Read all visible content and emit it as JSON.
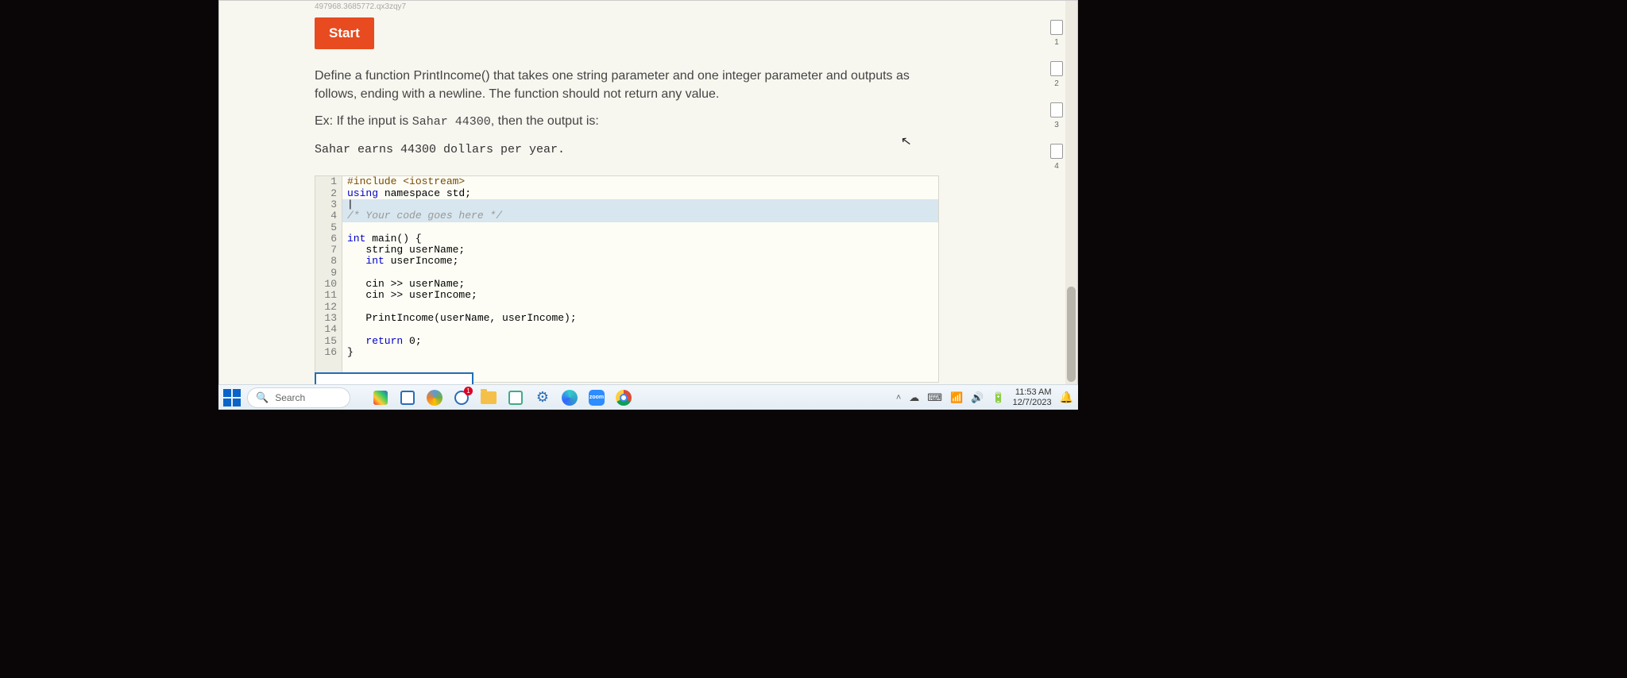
{
  "header_hash": "497968.3685772.qx3zqy7",
  "start_label": "Start",
  "prompt_text": "Define a function PrintIncome() that takes one string parameter and one integer parameter and outputs as follows, ending with a newline. The function should not return any value.",
  "example_prefix": "Ex: If the input is ",
  "example_input": "Sahar 44300",
  "example_suffix": ", then the output is:",
  "example_output": "Sahar earns 44300 dollars per year.",
  "code": {
    "l1": "#include <iostream>",
    "l2_a": "using",
    "l2_b": " namespace std;",
    "l3": "|",
    "l4": "/* Your code goes here */",
    "l5": "",
    "l6_a": "int",
    "l6_b": " main() {",
    "l7": "   string userName;",
    "l8_a": "   ",
    "l8_b": "int",
    "l8_c": " userIncome;",
    "l9": "",
    "l10": "   cin >> userName;",
    "l11": "   cin >> userIncome;",
    "l12": "",
    "l13": "   PrintIncome(userName, userIncome);",
    "l14": "",
    "l15_a": "   ",
    "l15_b": "return",
    "l15_c": " 0;",
    "l16": "}"
  },
  "line_numbers": [
    "1",
    "2",
    "3",
    "4",
    "5",
    "6",
    "7",
    "8",
    "9",
    "10",
    "11",
    "12",
    "13",
    "14",
    "15",
    "16"
  ],
  "steps": [
    "1",
    "2",
    "3",
    "4"
  ],
  "taskbar": {
    "search_placeholder": "Search",
    "chat_badge": "1",
    "zoom_label": "zoom",
    "time": "11:53 AM",
    "date": "12/7/2023"
  }
}
